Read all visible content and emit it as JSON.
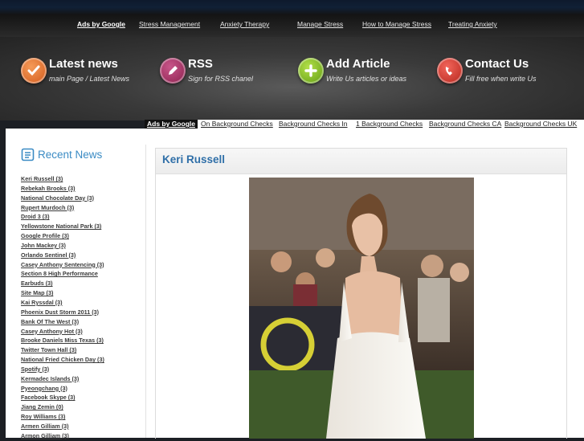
{
  "top_ads": {
    "label": "Ads by Google",
    "links": [
      "Stress Management",
      "Anxiety Therapy",
      "Manage Stress",
      "How to Manage Stress",
      "Treating Anxiety"
    ]
  },
  "nav": [
    {
      "title": "Latest news",
      "subtitle": "main Page / Latest News",
      "icon": "check-icon",
      "color": "#e8742a"
    },
    {
      "title": "RSS",
      "subtitle": "Sign for RSS chanel",
      "icon": "pencil-icon",
      "color": "#a52a5c"
    },
    {
      "title": "Add Article",
      "subtitle": "Write Us articles or ideas",
      "icon": "plus-icon",
      "color": "#7fb51a"
    },
    {
      "title": "Contact Us",
      "subtitle": "Fill free when write Us",
      "icon": "phone-icon",
      "color": "#d63a2a"
    }
  ],
  "second_ads": {
    "label": "Ads by Google",
    "links": [
      "On Background Checks",
      "Background Checks In",
      "1 Background Checks",
      "Background Checks CA",
      "Background Checks UK"
    ]
  },
  "sidebar": {
    "title": "Recent News",
    "items": [
      "Keri Russell (3)",
      "Rebekah Brooks (3)",
      "National Chocolate Day (3)",
      "Rupert Murdoch (3)",
      "Droid 3 (3)",
      "Yellowstone National Park (3)",
      "Google Profile (3)",
      "John Mackey (3)",
      "Orlando Sentinel (3)",
      "Casey Anthony Sentencing (3)",
      "Section 8 High Performance",
      "Earbuds (3)",
      "Site Map (3)",
      "Kai Ryssdal (3)",
      "Phoenix Dust Storm 2011 (3)",
      "Bank Of The West (3)",
      "Casey Anthony Hot (3)",
      "Brooke Daniels Miss Texas (3)",
      "Twitter Town Hall (3)",
      "National Fried Chicken Day (3)",
      "Spotify (3)",
      "Kermadec Islands (3)",
      "Pyeongchang (3)",
      "Facebook Skype (3)",
      "Jiang Zemin (0)",
      "Roy Williams (3)",
      "Armen Gilliam (3)",
      "Armon Gilliam (3)"
    ]
  },
  "post": {
    "title": "Keri Russell"
  },
  "colors": {
    "accent": "#3a8bc4",
    "post_title": "#2f6fa8"
  }
}
